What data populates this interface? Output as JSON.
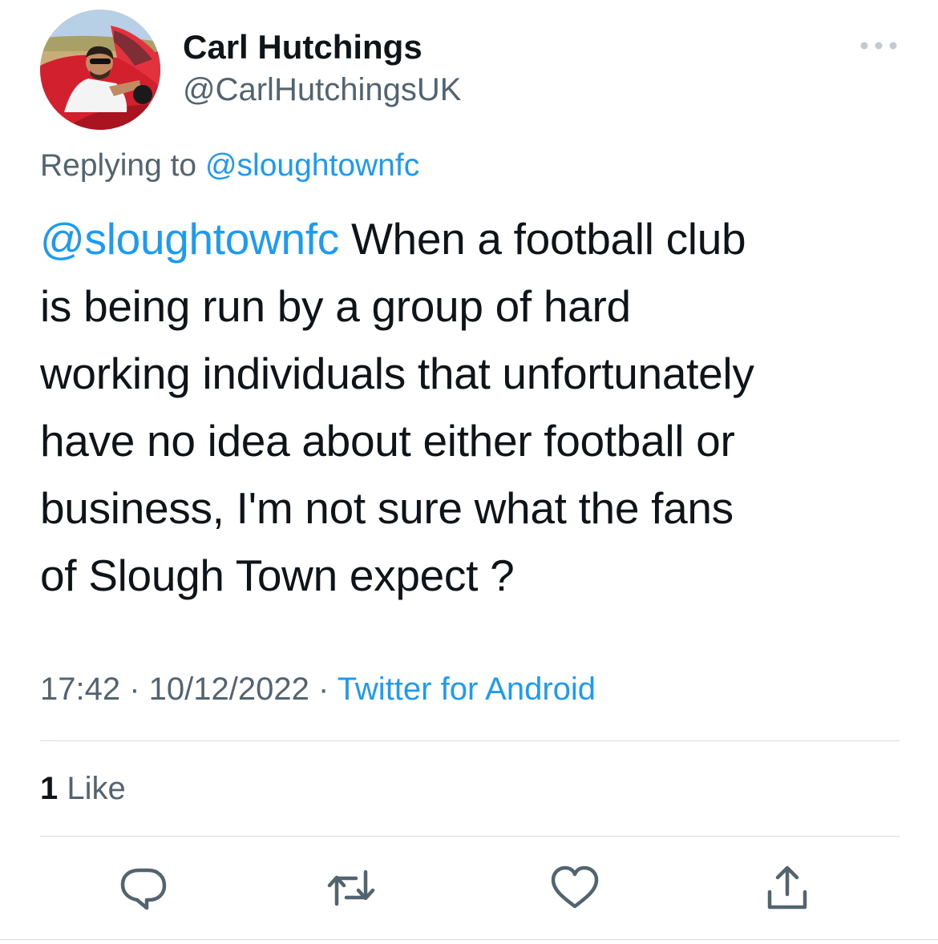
{
  "author": {
    "display_name": "Carl Hutchings",
    "handle": "@CarlHutchingsUK",
    "avatar": "profile-photo-man-in-red-convertible"
  },
  "reply": {
    "prefix": "Replying to",
    "to": "@sloughtownfc"
  },
  "tweet": {
    "mention": "@sloughtownfc",
    "lines": [
      " When a football club",
      "is being run by a group of hard",
      "working individuals that unfortunately",
      "have no idea about either football or",
      "business, I'm not sure what the fans",
      "of Slough Town expect ?"
    ]
  },
  "meta": {
    "time": "17:42",
    "separator": " · ",
    "date": "10/12/2022",
    "source": "Twitter for Android"
  },
  "stats": {
    "likes_count": "1",
    "likes_label": "Like"
  },
  "actions": [
    {
      "icon": "reply-icon"
    },
    {
      "icon": "retweet-icon"
    },
    {
      "icon": "heart-icon"
    },
    {
      "icon": "share-icon"
    }
  ],
  "colors": {
    "link": "#1d9bf0",
    "text": "#0f1419",
    "secondary": "#536471",
    "divider": "#d9dde1"
  }
}
